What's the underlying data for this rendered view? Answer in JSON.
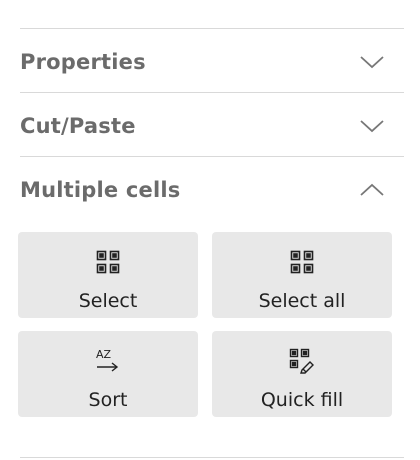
{
  "sections": [
    {
      "title": "Properties",
      "expanded": false
    },
    {
      "title": "Cut/Paste",
      "expanded": false
    },
    {
      "title": "Multiple cells",
      "expanded": true
    }
  ],
  "actions": [
    {
      "label": "Select",
      "icon": "grid-icon"
    },
    {
      "label": "Select all",
      "icon": "grid-icon"
    },
    {
      "label": "Sort",
      "icon": "sort-az-icon",
      "icon_text": "AZ"
    },
    {
      "label": "Quick fill",
      "icon": "quick-fill-icon"
    }
  ],
  "colors": {
    "tile_bg": "#e8e8e8",
    "header_text": "#6b6b6b",
    "divider": "#d9d9d9"
  }
}
